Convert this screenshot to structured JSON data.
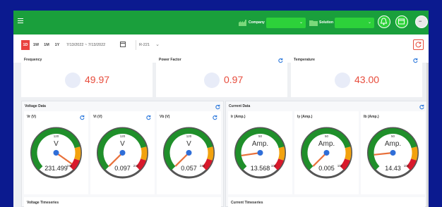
{
  "header": {
    "company_label": "Company",
    "solution_label": "Solution",
    "colors": {
      "bar": "#1a9f3c",
      "select": "#2dd13a"
    }
  },
  "toolbar": {
    "ranges": [
      "1D",
      "1W",
      "1M",
      "1Y"
    ],
    "active_range": "1D",
    "date_range": "7/13/2022 ~ 7/13/2022",
    "device": "R-221"
  },
  "stats": [
    {
      "title": "Frequency",
      "value": "49.97"
    },
    {
      "title": "Power Factor",
      "value": "0.97"
    },
    {
      "title": "Temperature",
      "value": "43.00"
    }
  ],
  "voltage": {
    "title": "Voltage Data",
    "timeseries_title": "Voltage Timeseries",
    "gauges": [
      {
        "label": "Vr (V)",
        "unit": "V",
        "value": "231.499",
        "reading": 231.499,
        "mid_tick": "120",
        "high_tick": "240",
        "min": 0,
        "max": 240
      },
      {
        "label": "Vi (V)",
        "unit": "V",
        "value": "0.097",
        "reading": 0.097,
        "mid_tick": "120",
        "high_tick": "240",
        "min": 0,
        "max": 240
      },
      {
        "label": "Vb (V)",
        "unit": "V",
        "value": "0.057",
        "reading": 0.057,
        "mid_tick": "120",
        "high_tick": "240",
        "min": 0,
        "max": 240
      }
    ]
  },
  "current": {
    "title": "Current Data",
    "timeseries_title": "Current Timeseries",
    "gauges": [
      {
        "label": "Ir (Amp.)",
        "unit": "Amp.",
        "value": "13.568",
        "reading": 13.568,
        "mid_tick": "50",
        "high_tick": "100",
        "min": 0,
        "max": 100
      },
      {
        "label": "Iy (Amp.)",
        "unit": "Amp.",
        "value": "0.005",
        "reading": 0.005,
        "mid_tick": "50",
        "high_tick": "100",
        "min": 0,
        "max": 100
      },
      {
        "label": "Ib (Amp.)",
        "unit": "Amp.",
        "value": "14.43",
        "reading": 14.43,
        "mid_tick": "50",
        "high_tick": "100",
        "min": 0,
        "max": 100
      }
    ]
  },
  "icons": {
    "menu": "hamburger-icon",
    "company": "factory-icon",
    "solution": "folder-icon",
    "notifications": "bell-icon",
    "calendar_btn": "calendar-icon",
    "user": "avatar-icon",
    "refresh": "refresh-icon"
  },
  "colors": {
    "value_red": "#e74c3c",
    "refresh_blue": "#1e6fd9",
    "active_range": "#e9413e"
  }
}
